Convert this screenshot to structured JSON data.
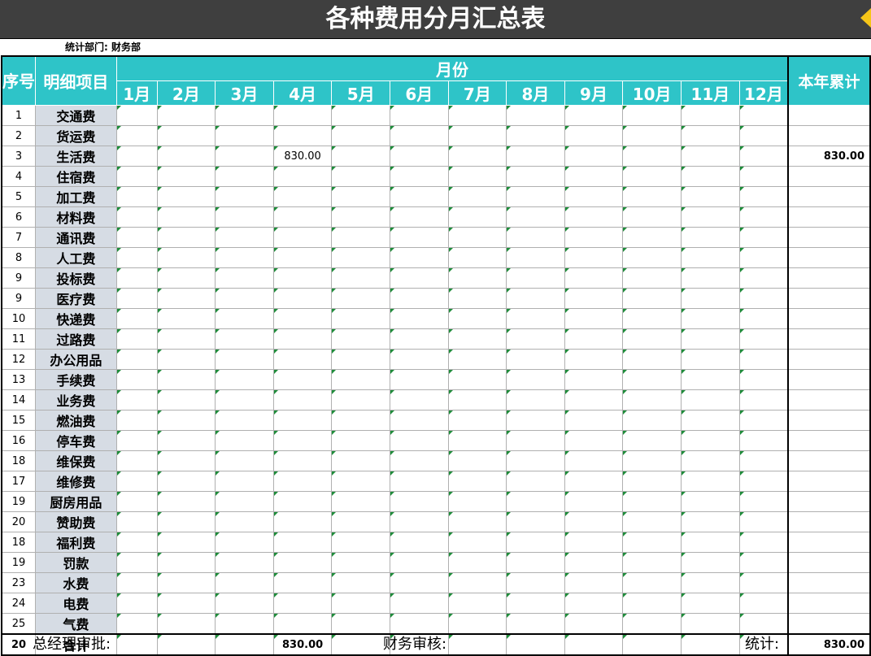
{
  "title": "各种费用分月汇总表",
  "department_label": "统计部门: 财务部",
  "headers": {
    "seq": "序号",
    "item": "明细项目",
    "month_group": "月份",
    "months": [
      "1月",
      "2月",
      "3月",
      "4月",
      "5月",
      "6月",
      "7月",
      "8月",
      "9月",
      "10月",
      "11月",
      "12月"
    ],
    "annual": "本年累计"
  },
  "rows": [
    {
      "seq": "1",
      "item": "交通费",
      "months": [
        "",
        "",
        "",
        "",
        "",
        "",
        "",
        "",
        "",
        "",
        "",
        ""
      ],
      "annual": ""
    },
    {
      "seq": "2",
      "item": "货运费",
      "months": [
        "",
        "",
        "",
        "",
        "",
        "",
        "",
        "",
        "",
        "",
        "",
        ""
      ],
      "annual": ""
    },
    {
      "seq": "3",
      "item": "生活费",
      "months": [
        "",
        "",
        "",
        "830.00",
        "",
        "",
        "",
        "",
        "",
        "",
        "",
        ""
      ],
      "annual": "830.00"
    },
    {
      "seq": "4",
      "item": "住宿费",
      "months": [
        "",
        "",
        "",
        "",
        "",
        "",
        "",
        "",
        "",
        "",
        "",
        ""
      ],
      "annual": ""
    },
    {
      "seq": "5",
      "item": "加工费",
      "months": [
        "",
        "",
        "",
        "",
        "",
        "",
        "",
        "",
        "",
        "",
        "",
        ""
      ],
      "annual": ""
    },
    {
      "seq": "6",
      "item": "材料费",
      "months": [
        "",
        "",
        "",
        "",
        "",
        "",
        "",
        "",
        "",
        "",
        "",
        ""
      ],
      "annual": ""
    },
    {
      "seq": "7",
      "item": "通讯费",
      "months": [
        "",
        "",
        "",
        "",
        "",
        "",
        "",
        "",
        "",
        "",
        "",
        ""
      ],
      "annual": ""
    },
    {
      "seq": "8",
      "item": "人工费",
      "months": [
        "",
        "",
        "",
        "",
        "",
        "",
        "",
        "",
        "",
        "",
        "",
        ""
      ],
      "annual": ""
    },
    {
      "seq": "9",
      "item": "投标费",
      "months": [
        "",
        "",
        "",
        "",
        "",
        "",
        "",
        "",
        "",
        "",
        "",
        ""
      ],
      "annual": ""
    },
    {
      "seq": "9",
      "item": "医疗费",
      "months": [
        "",
        "",
        "",
        "",
        "",
        "",
        "",
        "",
        "",
        "",
        "",
        ""
      ],
      "annual": ""
    },
    {
      "seq": "10",
      "item": "快递费",
      "months": [
        "",
        "",
        "",
        "",
        "",
        "",
        "",
        "",
        "",
        "",
        "",
        ""
      ],
      "annual": ""
    },
    {
      "seq": "11",
      "item": "过路费",
      "months": [
        "",
        "",
        "",
        "",
        "",
        "",
        "",
        "",
        "",
        "",
        "",
        ""
      ],
      "annual": ""
    },
    {
      "seq": "12",
      "item": "办公用品",
      "months": [
        "",
        "",
        "",
        "",
        "",
        "",
        "",
        "",
        "",
        "",
        "",
        ""
      ],
      "annual": ""
    },
    {
      "seq": "13",
      "item": "手续费",
      "months": [
        "",
        "",
        "",
        "",
        "",
        "",
        "",
        "",
        "",
        "",
        "",
        ""
      ],
      "annual": ""
    },
    {
      "seq": "14",
      "item": "业务费",
      "months": [
        "",
        "",
        "",
        "",
        "",
        "",
        "",
        "",
        "",
        "",
        "",
        ""
      ],
      "annual": ""
    },
    {
      "seq": "15",
      "item": "燃油费",
      "months": [
        "",
        "",
        "",
        "",
        "",
        "",
        "",
        "",
        "",
        "",
        "",
        ""
      ],
      "annual": ""
    },
    {
      "seq": "16",
      "item": "停车费",
      "months": [
        "",
        "",
        "",
        "",
        "",
        "",
        "",
        "",
        "",
        "",
        "",
        ""
      ],
      "annual": ""
    },
    {
      "seq": "18",
      "item": "维保费",
      "months": [
        "",
        "",
        "",
        "",
        "",
        "",
        "",
        "",
        "",
        "",
        "",
        ""
      ],
      "annual": ""
    },
    {
      "seq": "17",
      "item": "维修费",
      "months": [
        "",
        "",
        "",
        "",
        "",
        "",
        "",
        "",
        "",
        "",
        "",
        ""
      ],
      "annual": ""
    },
    {
      "seq": "19",
      "item": "厨房用品",
      "months": [
        "",
        "",
        "",
        "",
        "",
        "",
        "",
        "",
        "",
        "",
        "",
        ""
      ],
      "annual": ""
    },
    {
      "seq": "20",
      "item": "赞助费",
      "months": [
        "",
        "",
        "",
        "",
        "",
        "",
        "",
        "",
        "",
        "",
        "",
        ""
      ],
      "annual": ""
    },
    {
      "seq": "18",
      "item": "福利费",
      "months": [
        "",
        "",
        "",
        "",
        "",
        "",
        "",
        "",
        "",
        "",
        "",
        ""
      ],
      "annual": ""
    },
    {
      "seq": "19",
      "item": "罚款",
      "months": [
        "",
        "",
        "",
        "",
        "",
        "",
        "",
        "",
        "",
        "",
        "",
        ""
      ],
      "annual": ""
    },
    {
      "seq": "23",
      "item": "水费",
      "months": [
        "",
        "",
        "",
        "",
        "",
        "",
        "",
        "",
        "",
        "",
        "",
        ""
      ],
      "annual": ""
    },
    {
      "seq": "24",
      "item": "电费",
      "months": [
        "",
        "",
        "",
        "",
        "",
        "",
        "",
        "",
        "",
        "",
        "",
        ""
      ],
      "annual": ""
    },
    {
      "seq": "25",
      "item": "气费",
      "months": [
        "",
        "",
        "",
        "",
        "",
        "",
        "",
        "",
        "",
        "",
        "",
        ""
      ],
      "annual": ""
    }
  ],
  "total_row": {
    "seq": "20",
    "item": "合计",
    "months": [
      "",
      "",
      "",
      "830.00",
      "",
      "",
      "",
      "",
      "",
      "",
      "",
      ""
    ],
    "annual": "830.00"
  },
  "footer": {
    "approve": "总经理审批:",
    "finance": "财务审核:",
    "stats": "统计:"
  },
  "colors": {
    "header_bg": "#2ec4c8",
    "title_bg": "#3f3f3f",
    "item_bg": "#d6dce4",
    "marker": "#f5c518"
  }
}
